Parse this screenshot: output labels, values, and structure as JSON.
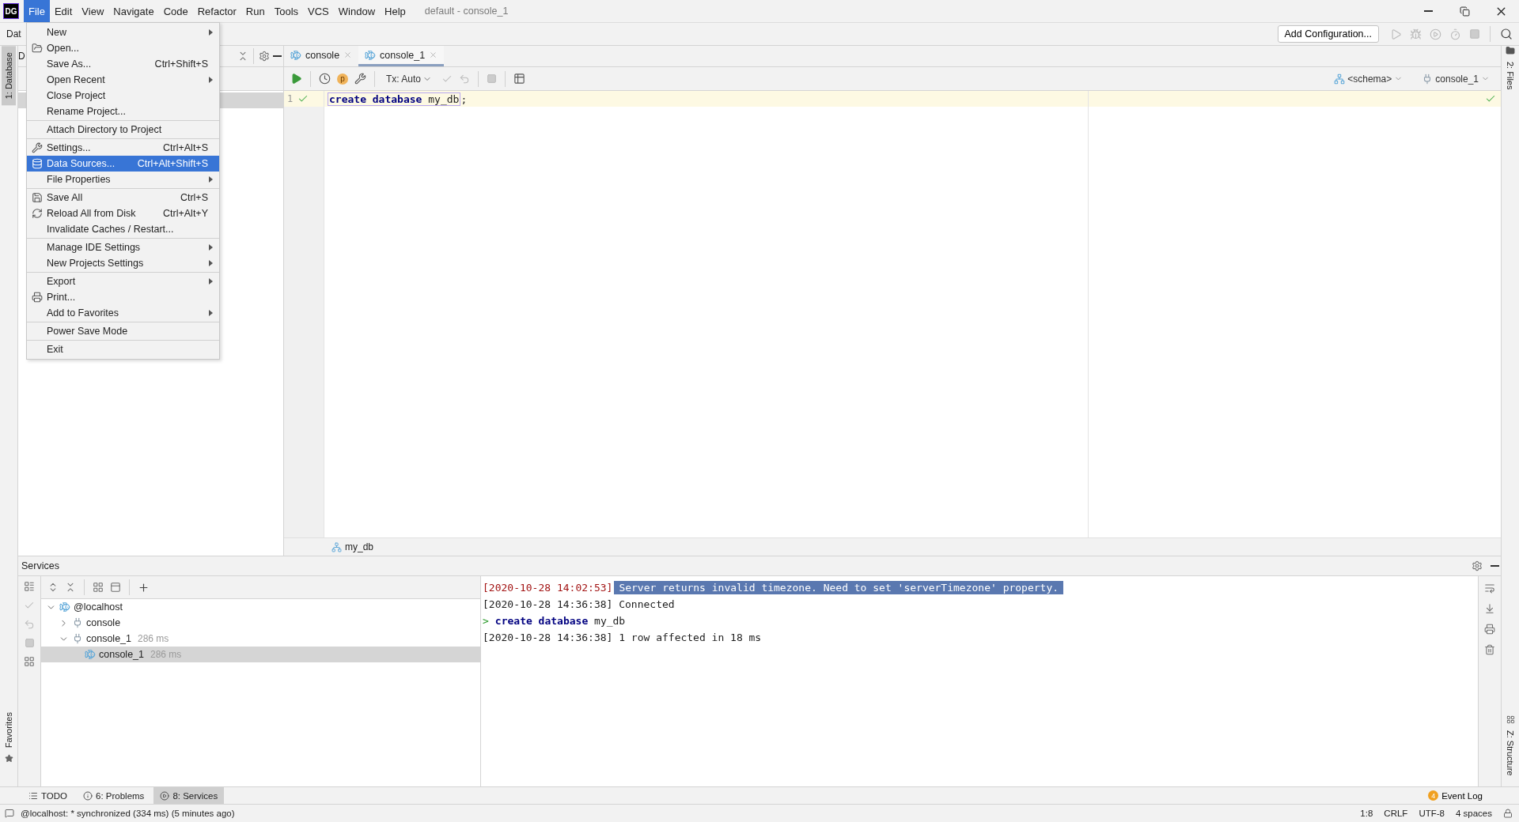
{
  "app_bar": {
    "logo": "DG",
    "menus": [
      {
        "label": "File",
        "selected": true
      },
      {
        "label": "Edit",
        "selected": false
      },
      {
        "label": "View",
        "selected": false
      },
      {
        "label": "Navigate",
        "selected": false
      },
      {
        "label": "Code",
        "selected": false
      },
      {
        "label": "Refactor",
        "selected": false
      },
      {
        "label": "Run",
        "selected": false
      },
      {
        "label": "Tools",
        "selected": false
      },
      {
        "label": "VCS",
        "selected": false
      },
      {
        "label": "Window",
        "selected": false
      },
      {
        "label": "Help",
        "selected": false
      }
    ],
    "title": "default - console_1"
  },
  "toolbar": {
    "cut_label": "Dat",
    "run_config": "Add Configuration..."
  },
  "left_stripe": {
    "tabs": [
      {
        "label": "1: Database",
        "selected": true
      }
    ],
    "bottom_tab": "Favorites"
  },
  "right_stripe": {
    "top_tab": "2: Files",
    "bottom_tab": "Z: Structure"
  },
  "database_panel": {
    "cut_label": "D"
  },
  "file_menu": {
    "items": [
      {
        "kind": "item",
        "label": "New",
        "submenu": true,
        "selected": false
      },
      {
        "kind": "item",
        "label": "Open...",
        "selected": false
      },
      {
        "kind": "item",
        "label": "Save As...",
        "shortcut": "Ctrl+Shift+S",
        "selected": false
      },
      {
        "kind": "item",
        "label": "Open Recent",
        "submenu": true,
        "selected": false
      },
      {
        "kind": "item",
        "label": "Close Project",
        "selected": false
      },
      {
        "kind": "item",
        "label": "Rename Project...",
        "selected": false
      },
      {
        "kind": "separator"
      },
      {
        "kind": "item",
        "label": "Attach Directory to Project",
        "selected": false
      },
      {
        "kind": "separator"
      },
      {
        "kind": "item",
        "label": "Settings...",
        "shortcut": "Ctrl+Alt+S",
        "selected": false
      },
      {
        "kind": "item",
        "label": "Data Sources...",
        "shortcut": "Ctrl+Alt+Shift+S",
        "selected": true
      },
      {
        "kind": "item",
        "label": "File Properties",
        "submenu": true,
        "selected": false
      },
      {
        "kind": "separator"
      },
      {
        "kind": "item",
        "label": "Save All",
        "shortcut": "Ctrl+S",
        "selected": false
      },
      {
        "kind": "item",
        "label": "Reload All from Disk",
        "shortcut": "Ctrl+Alt+Y",
        "selected": false
      },
      {
        "kind": "item",
        "label": "Invalidate Caches / Restart...",
        "selected": false
      },
      {
        "kind": "separator"
      },
      {
        "kind": "item",
        "label": "Manage IDE Settings",
        "submenu": true,
        "selected": false
      },
      {
        "kind": "item",
        "label": "New Projects Settings",
        "submenu": true,
        "selected": false
      },
      {
        "kind": "separator"
      },
      {
        "kind": "item",
        "label": "Export",
        "submenu": true,
        "selected": false
      },
      {
        "kind": "item",
        "label": "Print...",
        "selected": false
      },
      {
        "kind": "item",
        "label": "Add to Favorites",
        "submenu": true,
        "selected": false
      },
      {
        "kind": "separator"
      },
      {
        "kind": "item",
        "label": "Power Save Mode",
        "selected": false
      },
      {
        "kind": "separator"
      },
      {
        "kind": "item",
        "label": "Exit",
        "selected": false
      }
    ]
  },
  "editor": {
    "tabs": [
      {
        "label": "console",
        "selected": false
      },
      {
        "label": "console_1",
        "selected": true
      }
    ],
    "explain_badge": "p",
    "tx_mode": "Tx: Auto",
    "schema": "<schema>",
    "session": "console_1",
    "lines": [
      {
        "number": "1",
        "passed": true,
        "statement": [
          {
            "kind": "keyword",
            "text": "create database"
          },
          {
            "kind": "plain",
            "text": " my_db"
          }
        ],
        "tail": ";"
      }
    ],
    "breadcrumb": "my_db"
  },
  "services": {
    "title": "Services",
    "tree": [
      {
        "label": "@localhost",
        "expanded": true,
        "selected": false,
        "children": [
          {
            "label": "console",
            "expanded": false,
            "selected": false
          },
          {
            "label": "console_1",
            "time": "286 ms",
            "expanded": true,
            "selected": false,
            "children": [
              {
                "label": "console_1",
                "time": "286 ms",
                "selected": true
              }
            ]
          }
        ]
      }
    ],
    "console": [
      {
        "kind": "warning",
        "time": "[2020-10-28 14:02:53]",
        "message": "Server returns invalid timezone. Need to set 'serverTimezone' property."
      },
      {
        "kind": "info",
        "time": "[2020-10-28 14:36:38]",
        "message": "Connected"
      },
      {
        "kind": "command",
        "prompt": ">",
        "keyword": "create database",
        "text": "my_db"
      },
      {
        "kind": "info",
        "time": "[2020-10-28 14:36:38]",
        "message": "1 row affected in 18 ms"
      }
    ]
  },
  "bottom_tabs": [
    {
      "label": "TODO",
      "selected": false
    },
    {
      "label": "6: Problems",
      "selected": false
    },
    {
      "label": "8: Services",
      "selected": true
    }
  ],
  "event_log": {
    "label": "Event Log",
    "badge": "4"
  },
  "status_bar": {
    "message": "@localhost: * synchronized (334 ms) (5 minutes ago)",
    "items": [
      "1:8",
      "CRLF",
      "UTF-8",
      "4 spaces"
    ]
  }
}
